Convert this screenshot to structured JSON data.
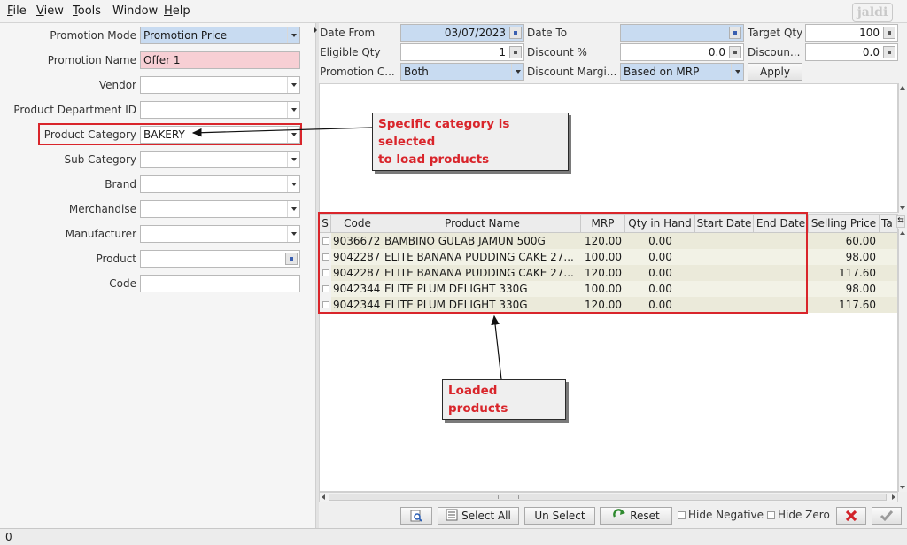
{
  "menu": {
    "items": [
      {
        "label": "File",
        "underline": "F",
        "rest": "ile"
      },
      {
        "label": "View",
        "underline": "V",
        "rest": "iew"
      },
      {
        "label": "Tools",
        "underline": "T",
        "rest": "ools"
      },
      {
        "label": "Window",
        "underline": "",
        "rest": "Window"
      },
      {
        "label": "Help",
        "underline": "H",
        "rest": "elp"
      }
    ],
    "logo_text": "jaldi"
  },
  "filters": {
    "promotion_mode_label": "Promotion Mode",
    "promotion_mode_value": "Promotion Price",
    "promotion_name_label": "Promotion Name",
    "promotion_name_value": "Offer 1",
    "vendor_label": "Vendor",
    "department_label": "Product Department ID",
    "category_label": "Product Category",
    "category_value": "BAKERY",
    "subcategory_label": "Sub Category",
    "brand_label": "Brand",
    "merchandise_label": "Merchandise",
    "manufacturer_label": "Manufacturer",
    "product_label": "Product",
    "code_label": "Code"
  },
  "params": {
    "date_from_label": "Date From",
    "date_from_value": "03/07/2023",
    "date_to_label": "Date To",
    "date_to_value": "",
    "target_qty_label": "Target Qty",
    "target_qty_value": "100",
    "eligible_qty_label": "Eligible Qty",
    "eligible_qty_value": "1",
    "discount_pct_label": "Discount %",
    "discount_pct_value": "0.0",
    "discount_amt_label": "Discoun...",
    "discount_amt_value": "0.0",
    "promotion_c_label": "Promotion C...",
    "promotion_c_value": "Both",
    "discount_margin_label": "Discount Margi...",
    "discount_margin_value": "Based on MRP",
    "apply_label": "Apply"
  },
  "table": {
    "columns": [
      "S",
      "Code",
      "Product Name",
      "MRP",
      "Qty in Hand",
      "Start Date",
      "End Date",
      "Selling Price",
      "Ta"
    ],
    "rows": [
      {
        "code": "9036672",
        "name": "BAMBINO GULAB JAMUN 500G",
        "mrp": "120.00",
        "qty": "0.00",
        "start": "",
        "end": "",
        "price": "60.00"
      },
      {
        "code": "9042287",
        "name": "ELITE BANANA PUDDING CAKE 27...",
        "mrp": "100.00",
        "qty": "0.00",
        "start": "",
        "end": "",
        "price": "98.00"
      },
      {
        "code": "9042287",
        "name": "ELITE BANANA PUDDING CAKE 27...",
        "mrp": "120.00",
        "qty": "0.00",
        "start": "",
        "end": "",
        "price": "117.60"
      },
      {
        "code": "9042344",
        "name": "ELITE PLUM DELIGHT 330G",
        "mrp": "100.00",
        "qty": "0.00",
        "start": "",
        "end": "",
        "price": "98.00"
      },
      {
        "code": "9042344",
        "name": "ELITE PLUM DELIGHT 330G",
        "mrp": "120.00",
        "qty": "0.00",
        "start": "",
        "end": "",
        "price": "117.60"
      }
    ]
  },
  "toolbar": {
    "select_all_label": "Select All",
    "select_all_underline": "A",
    "unselect_label": "Un Select",
    "reset_label": "Reset",
    "reset_underline": "R",
    "hide_negative_label": "Hide Negative",
    "hide_zero_label": "Hide Zero"
  },
  "status": {
    "text": "0"
  },
  "annotations": {
    "category_callout_line1": "Specific category is selected",
    "category_callout_line2": "to load products",
    "products_callout": "Loaded products"
  },
  "colors": {
    "annotation_red": "#d9252b",
    "field_blue": "#c8dbf1",
    "field_pink": "#f7cfd4",
    "row_even": "#ebeada"
  },
  "icons": {
    "calendar": "calendar-icon",
    "search": "search-icon",
    "select_all": "select-all-icon",
    "reset": "reset-icon",
    "cancel": "close-icon",
    "ok": "check-icon"
  }
}
